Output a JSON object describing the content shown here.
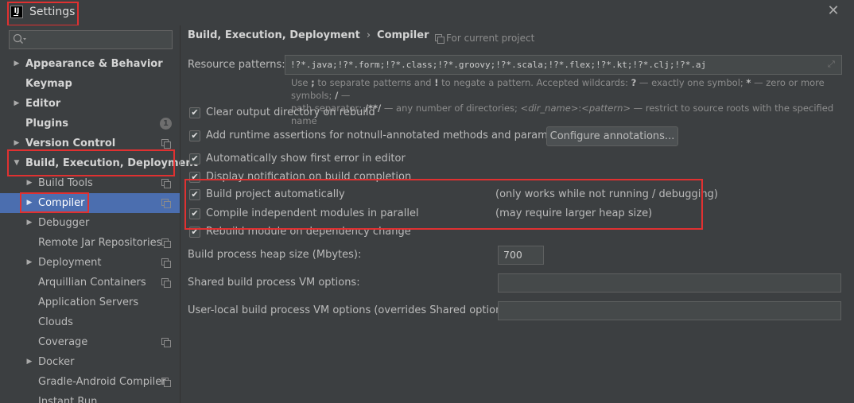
{
  "window": {
    "title": "Settings",
    "logo_text": "IJ",
    "close_glyph": "✕"
  },
  "sidebar": {
    "search": {
      "placeholder": "",
      "value": ""
    },
    "items": [
      {
        "label": "Appearance & Behavior",
        "arrow": "▶",
        "bold": true
      },
      {
        "label": "Keymap",
        "bold": true
      },
      {
        "label": "Editor",
        "arrow": "▶",
        "bold": true
      },
      {
        "label": "Plugins",
        "bold": true,
        "badge": "1"
      },
      {
        "label": "Version Control",
        "arrow": "▶",
        "bold": true
      },
      {
        "label": "Build, Execution, Deployment",
        "arrow": "▼",
        "bold": true
      },
      {
        "label": "Build Tools",
        "arrow": "▶"
      },
      {
        "label": "Compiler",
        "arrow": "▶",
        "selected": true
      },
      {
        "label": "Debugger",
        "arrow": "▶"
      },
      {
        "label": "Remote Jar Repositories"
      },
      {
        "label": "Deployment",
        "arrow": "▶"
      },
      {
        "label": "Arquillian Containers"
      },
      {
        "label": "Application Servers"
      },
      {
        "label": "Clouds"
      },
      {
        "label": "Coverage"
      },
      {
        "label": "Docker",
        "arrow": "▶"
      },
      {
        "label": "Gradle-Android Compiler"
      },
      {
        "label": "Instant Run"
      }
    ]
  },
  "main": {
    "breadcrumb": {
      "parent": "Build, Execution, Deployment",
      "separator": "›",
      "current": "Compiler"
    },
    "for_current_project": "For current project",
    "resource_patterns": {
      "label": "Resource patterns:",
      "value": "!?*.java;!?*.form;!?*.class;!?*.groovy;!?*.scala;!?*.flex;!?*.kt;!?*.clj;!?*.aj",
      "expand_glyph": "⤢"
    },
    "hint": {
      "line1_a": "Use ",
      "line1_b": ";",
      "line1_c": " to separate patterns and ",
      "line1_d": "!",
      "line1_e": " to negate a pattern. Accepted wildcards: ",
      "line1_f": "?",
      "line1_g": " — exactly one symbol; ",
      "line1_h": "*",
      "line1_i": " — zero or more symbols; ",
      "line1_j": "/",
      "line1_k": " —",
      "line2_a": "path separator; ",
      "line2_b": "/**/",
      "line2_c": " — any number of directories; ",
      "line2_d": "<dir_name>",
      "line2_e": ":",
      "line2_f": "<pattern>",
      "line2_g": " — restrict to source roots with the specified name"
    },
    "checkboxes": [
      {
        "label": "Clear output directory on rebuild",
        "checked": true
      },
      {
        "label": "Add runtime assertions for notnull-annotated methods and parameters",
        "checked": true
      },
      {
        "label": "Automatically show first error in editor",
        "checked": true
      },
      {
        "label": "Display notification on build completion",
        "checked": true
      },
      {
        "label": "Build project automatically",
        "checked": true,
        "note": "(only works while not running / debugging)"
      },
      {
        "label": "Compile independent modules in parallel",
        "checked": true,
        "note": "(may require larger heap size)"
      },
      {
        "label": "Rebuild module on dependency change",
        "checked": true
      }
    ],
    "check_glyph": "✔",
    "configure_annotations_button": "Configure annotations...",
    "heap_size": {
      "label": "Build process heap size (Mbytes):",
      "value": "700"
    },
    "shared_vm_options": {
      "label": "Shared build process VM options:",
      "value": ""
    },
    "user_local_vm_options": {
      "label": "User-local build process VM options (overrides Shared options):",
      "value": ""
    }
  }
}
